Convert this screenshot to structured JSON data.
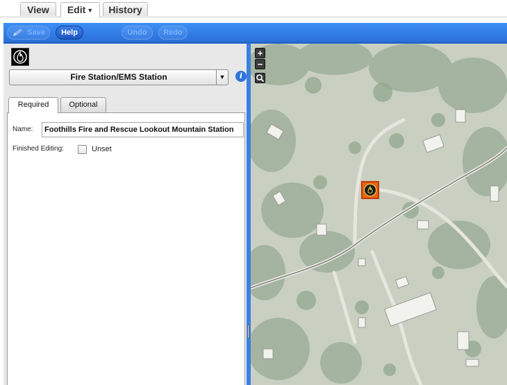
{
  "top_tabs": {
    "view": "View",
    "edit": "Edit",
    "history": "History"
  },
  "toolbar": {
    "save": "Save",
    "help": "Help",
    "undo": "Undo",
    "redo": "Redo"
  },
  "preset": {
    "name": "Fire Station/EMS Station",
    "icon": "fire-station-icon"
  },
  "tabs": {
    "required": "Required",
    "optional": "Optional"
  },
  "fields": {
    "name_label": "Name:",
    "name_value": "Foothills Fire and Rescue Lookout Mountain Station",
    "finished_label": "Finished Editing:",
    "finished_value": "Unset"
  },
  "map": {
    "zoom_in": "+",
    "zoom_out": "−",
    "marker_icon": "fire-station-icon"
  },
  "colors": {
    "toolbar": "#2b6fd6",
    "marker": "#e8641c"
  }
}
